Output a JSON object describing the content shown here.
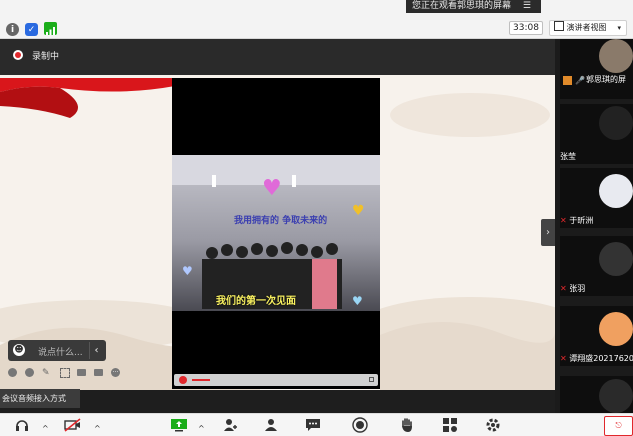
{
  "topbar": {
    "viewing_text": "您正在观看郭思琪的屏幕",
    "timer": "33:08",
    "view_mode": "演讲者视图"
  },
  "recording": {
    "label": "录制中"
  },
  "stage": {
    "video_caption_top": "我用拥有的 争取未来的",
    "video_caption_bottom": "我们的第一次见面"
  },
  "chat": {
    "placeholder": "说点什么..."
  },
  "audio_hint": "会议音频接入方式",
  "participants": [
    {
      "name": "郭思琪的屏"
    },
    {
      "name": "张莹"
    },
    {
      "name": "于昕洲"
    },
    {
      "name": "张羽"
    },
    {
      "name": "谭翔盛20217620"
    }
  ],
  "colors": {
    "recording_red": "#e0282c",
    "accent_green": "#1aad19"
  }
}
